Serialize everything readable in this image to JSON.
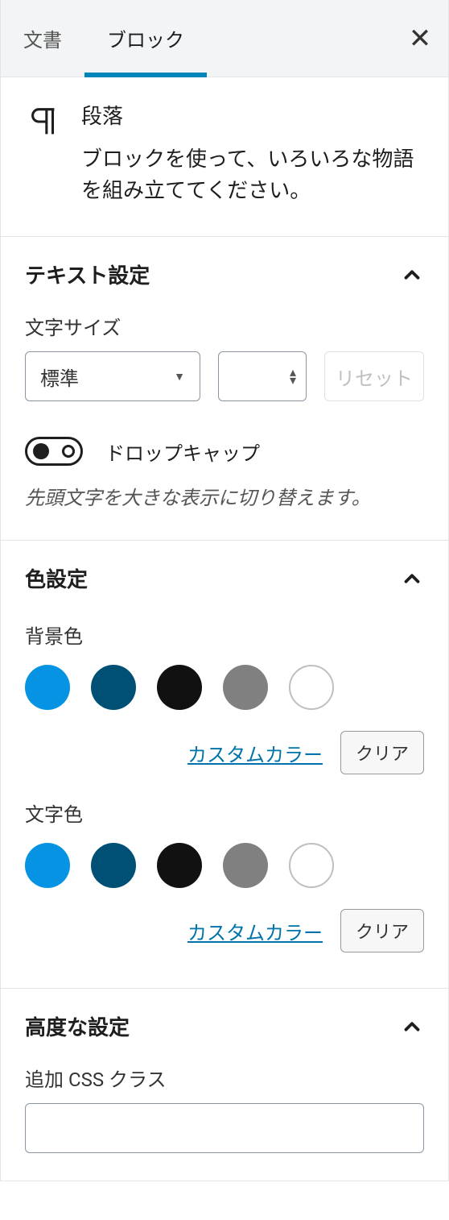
{
  "tabs": {
    "document": "文書",
    "block": "ブロック",
    "close_aria": "閉じる"
  },
  "block_card": {
    "title": "段落",
    "description": "ブロックを使って、いろいろな物語を組み立ててください。"
  },
  "sections": {
    "text": {
      "heading": "テキスト設定",
      "font_size_label": "文字サイズ",
      "font_size_value": "標準",
      "reset_label": "リセット",
      "dropcap_label": "ドロップキャップ",
      "dropcap_hint": "先頭文字を大きな表示に切り替えます。"
    },
    "color": {
      "heading": "色設定",
      "background_label": "背景色",
      "text_label": "文字色",
      "custom_label": "カスタムカラー",
      "clear_label": "クリア",
      "palette": [
        {
          "name": "vivid-cyan-blue",
          "hex": "#0693e3"
        },
        {
          "name": "dark-cyan",
          "hex": "#005075"
        },
        {
          "name": "black",
          "hex": "#111111"
        },
        {
          "name": "gray",
          "hex": "#808080"
        },
        {
          "name": "white",
          "hex": "#ffffff"
        }
      ]
    },
    "advanced": {
      "heading": "高度な設定",
      "css_class_label": "追加 CSS クラス",
      "css_class_value": ""
    }
  }
}
